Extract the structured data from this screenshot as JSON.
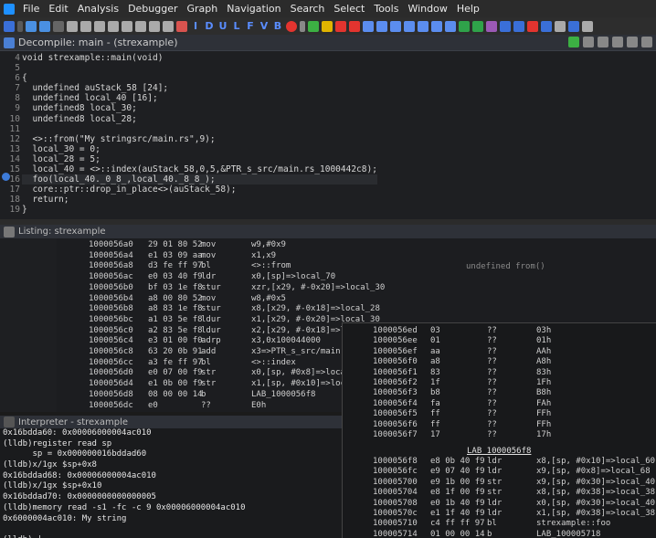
{
  "menubar": {
    "items": [
      "File",
      "Edit",
      "Analysis",
      "Debugger",
      "Graph",
      "Navigation",
      "Search",
      "Select",
      "Tools",
      "Window",
      "Help"
    ]
  },
  "toolbar": {
    "letter_buttons": [
      "I",
      "D",
      "U",
      "L",
      "F",
      "V",
      "B"
    ]
  },
  "decompile": {
    "title": "Decompile: main -  (strexample)",
    "line_numbers": [
      "4",
      "5",
      "6",
      "7",
      "8",
      "9",
      "10",
      "11",
      "12",
      "13",
      "14",
      "15",
      "16",
      "17",
      "18",
      "19"
    ],
    "lines": [
      "void strexample::main(void)",
      "",
      "{",
      "  undefined auStack_58 [24];",
      "  undefined local_40 [16];",
      "  undefined8 local_30;",
      "  undefined8 local_28;",
      "",
      "  <>::from(\"My stringsrc/main.rs\",9);",
      "  local_30 = 0;",
      "  local_28 = 5;",
      "  local_40 = <>::index(auStack_58,0,5,&PTR_s_src/main.rs_1000442c8);",
      "  foo(local_40._0_8_,local_40._8_8_);",
      "  core::ptr::drop_in_place<>(auStack_58);",
      "  return;",
      "}"
    ]
  },
  "listing": {
    "title": "Listing:  strexample",
    "undefined_label": "undefined from()",
    "rows": [
      {
        "addr": "1000056a0",
        "bytes": "29 01 80 52",
        "op": "mov",
        "args": "w9,#0x9"
      },
      {
        "addr": "1000056a4",
        "bytes": "e1 03 09 aa",
        "op": "mov",
        "args": "x1,x9"
      },
      {
        "addr": "1000056a8",
        "bytes": "d3 fe ff 97",
        "op": "bl",
        "args": "<>::from"
      },
      {
        "addr": "1000056ac",
        "bytes": "e0 03 40 f9",
        "op": "ldr",
        "args": "x0,[sp]=>local_70"
      },
      {
        "addr": "1000056b0",
        "bytes": "bf 03 1e f8",
        "op": "stur",
        "args": "xzr,[x29, #-0x20]=>local_30"
      },
      {
        "addr": "1000056b4",
        "bytes": "a8 00 80 52",
        "op": "mov",
        "args": "w8,#0x5"
      },
      {
        "addr": "1000056b8",
        "bytes": "a8 83 1e f8",
        "op": "stur",
        "args": "x8,[x29, #-0x18]=>local_28"
      },
      {
        "addr": "1000056bc",
        "bytes": "a1 03 5e f8",
        "op": "ldur",
        "args": "x1,[x29, #-0x20]=>local_30"
      },
      {
        "addr": "1000056c0",
        "bytes": "a2 83 5e f8",
        "op": "ldur",
        "args": "x2,[x29, #-0x18]=>local_28"
      },
      {
        "addr": "1000056c4",
        "bytes": "e3 01 00 f0",
        "op": "adrp",
        "args": "x3,0x100044000"
      },
      {
        "addr": "1000056c8",
        "bytes": "63 20 0b 91",
        "op": "add",
        "args": "x3=>PTR_s_src/main.r"
      },
      {
        "addr": "1000056cc",
        "bytes": "a3 fe ff 97",
        "op": "bl",
        "args": "<>::index"
      },
      {
        "addr": "1000056d0",
        "bytes": "e0 07 00 f9",
        "op": "str",
        "args": "x0,[sp, #0x8]=>local"
      },
      {
        "addr": "1000056d4",
        "bytes": "e1 0b 00 f9",
        "op": "str",
        "args": "x1,[sp, #0x10]=>local"
      },
      {
        "addr": "1000056d8",
        "bytes": "08 00 00 14",
        "op": "b",
        "args": "LAB_1000056f8"
      },
      {
        "addr": "1000056dc",
        "bytes": "e0",
        "op": "??",
        "args": "E0h"
      }
    ]
  },
  "popup": {
    "rows": [
      {
        "addr": "1000056ed",
        "bytes": "03",
        "op": "??",
        "args": "03h"
      },
      {
        "addr": "1000056ee",
        "bytes": "01",
        "op": "??",
        "args": "01h"
      },
      {
        "addr": "1000056ef",
        "bytes": "aa",
        "op": "??",
        "args": "AAh"
      },
      {
        "addr": "1000056f0",
        "bytes": "a8",
        "op": "??",
        "args": "A8h"
      },
      {
        "addr": "1000056f1",
        "bytes": "83",
        "op": "??",
        "args": "83h"
      },
      {
        "addr": "1000056f2",
        "bytes": "1f",
        "op": "??",
        "args": "1Fh"
      },
      {
        "addr": "1000056f3",
        "bytes": "b8",
        "op": "??",
        "args": "B8h"
      },
      {
        "addr": "1000056f4",
        "bytes": "fa",
        "op": "??",
        "args": "FAh"
      },
      {
        "addr": "1000056f5",
        "bytes": "ff",
        "op": "??",
        "args": "FFh"
      },
      {
        "addr": "1000056f6",
        "bytes": "ff",
        "op": "??",
        "args": "FFh"
      },
      {
        "addr": "1000056f7",
        "bytes": "17",
        "op": "??",
        "args": "17h"
      }
    ],
    "label": "LAB_1000056f8",
    "rows2": [
      {
        "addr": "1000056f8",
        "bytes": "e8 0b 40 f9",
        "op": "ldr",
        "args": "x8,[sp, #0x10]=>local_60"
      },
      {
        "addr": "1000056fc",
        "bytes": "e9 07 40 f9",
        "op": "ldr",
        "args": "x9,[sp, #0x8]=>local_68"
      },
      {
        "addr": "100005700",
        "bytes": "e9 1b 00 f9",
        "op": "str",
        "args": "x9,[sp, #0x30]=>local_40"
      },
      {
        "addr": "100005704",
        "bytes": "e8 1f 00 f9",
        "op": "str",
        "args": "x8,[sp, #0x38]=>local_38"
      },
      {
        "addr": "100005708",
        "bytes": "e0 1b 40 f9",
        "op": "ldr",
        "args": "x0,[sp, #0x30]=>local_40"
      },
      {
        "addr": "10000570c",
        "bytes": "e1 1f 40 f9",
        "op": "ldr",
        "args": "x1,[sp, #0x38]=>local_38"
      },
      {
        "addr": "100005710",
        "bytes": "c4 ff ff 97",
        "op": "bl",
        "args": "strexample::foo"
      },
      {
        "addr": "100005714",
        "bytes": "01 00 00 14",
        "op": "b",
        "args": "LAB_100005718"
      }
    ]
  },
  "interpreter": {
    "title": "Interpreter - strexample",
    "lines": [
      "0x16bdda60: 0x00006000004ac010",
      "(lldb)register read sp",
      "      sp = 0x000000016bddad60",
      "(lldb)x/1gx $sp+0x8",
      "0x16bddad68: 0x00006000004ac010",
      "(lldb)x/1gx $sp+0x10",
      "0x16bddad70: 0x0000000000000005",
      "(lldb)memory read -s1 -fc -c 9 0x00006000004ac010",
      "0x6000004ac010: My string",
      "",
      "(lldb) |"
    ]
  }
}
